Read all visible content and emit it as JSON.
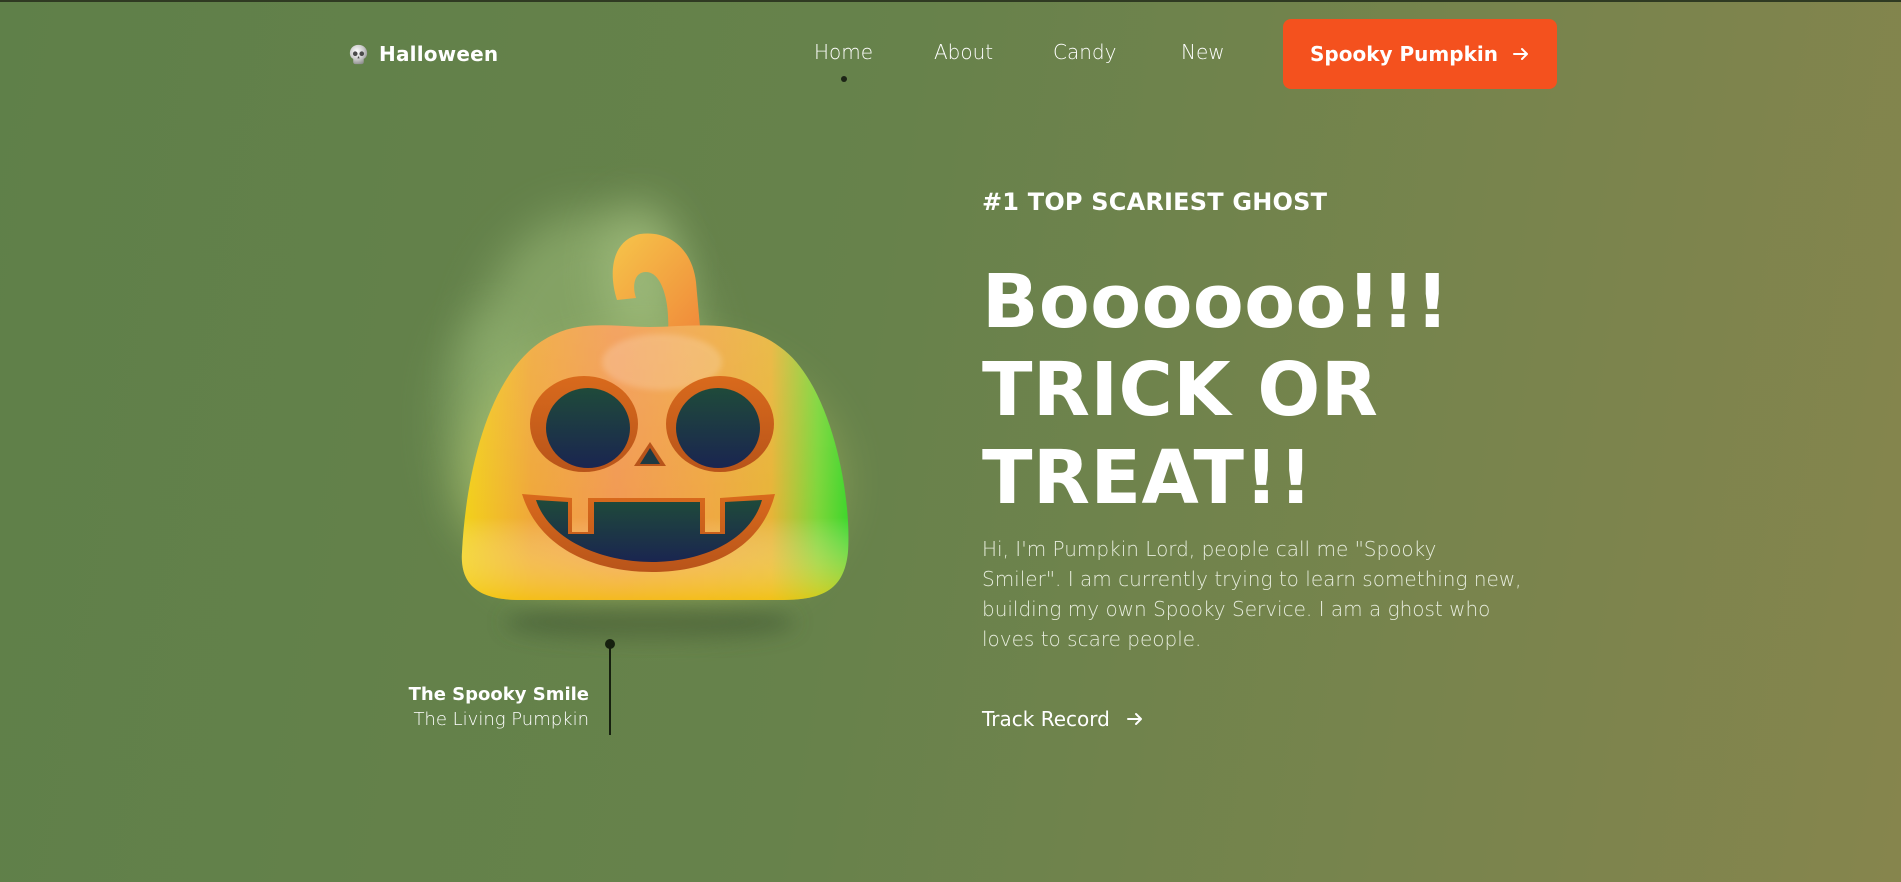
{
  "brand": {
    "name": "Halloween",
    "icon": "skull-icon"
  },
  "nav": {
    "items": [
      {
        "label": "Home",
        "active": true
      },
      {
        "label": "About",
        "active": false
      },
      {
        "label": "Candy",
        "active": false
      },
      {
        "label": "New",
        "active": false
      }
    ],
    "cta": {
      "label": "Spooky Pumpkin",
      "icon": "arrow-right-icon"
    }
  },
  "hero": {
    "eyebrow": "#1 TOP SCARIEST GHOST",
    "headline": [
      "Boooooo!!!",
      "TRICK OR",
      "TREAT!!"
    ],
    "description": "Hi, I'm Pumpkin Lord, people call me \"Spooky Smiler\". I am currently trying to learn something new, building my own Spooky Service. I am a ghost who loves to scare people.",
    "link": {
      "label": "Track Record",
      "icon": "arrow-right-icon"
    }
  },
  "caption": {
    "title": "The Spooky Smile",
    "subtitle": "The Living Pumpkin"
  },
  "colors": {
    "accent": "#f4511e",
    "background_start": "#5f8049",
    "background_end": "#86854d",
    "text": "#ffffff"
  }
}
